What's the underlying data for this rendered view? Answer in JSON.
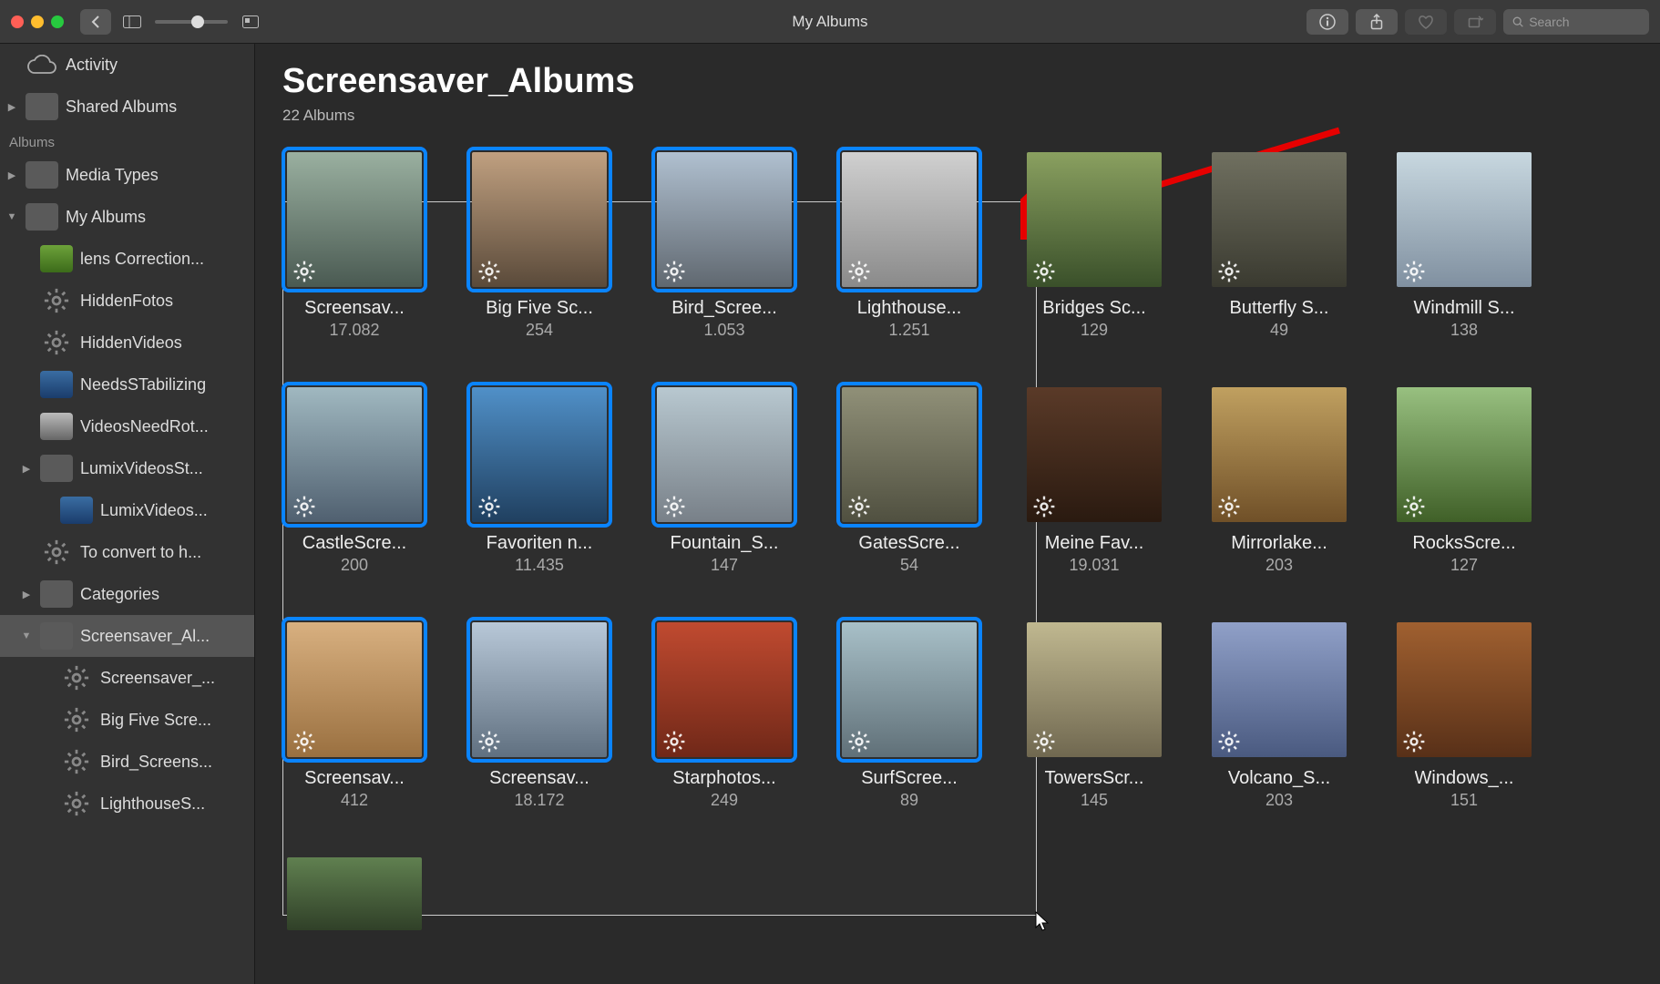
{
  "window": {
    "title": "My Albums"
  },
  "toolbar": {
    "search_placeholder": "Search"
  },
  "sidebar": {
    "activity_label": "Activity",
    "shared_albums_label": "Shared Albums",
    "section_label": "Albums",
    "media_types_label": "Media Types",
    "my_albums_label": "My Albums",
    "items": [
      {
        "label": "lens Correction...",
        "icon": "thumb-green"
      },
      {
        "label": "HiddenFotos",
        "icon": "gear"
      },
      {
        "label": "HiddenVideos",
        "icon": "gear"
      },
      {
        "label": "NeedsSTabilizing",
        "icon": "thumb-blue"
      },
      {
        "label": "VideosNeedRot...",
        "icon": "thumb-mix"
      },
      {
        "label": "LumixVideosSt...",
        "icon": "folder",
        "expandable": true
      },
      {
        "label": "LumixVideos...",
        "icon": "thumb-blue",
        "indent": 1
      },
      {
        "label": "To convert to h...",
        "icon": "gear"
      },
      {
        "label": "Categories",
        "icon": "folder",
        "expandable": true
      },
      {
        "label": "Screensaver_Al...",
        "icon": "folder",
        "expandable": true,
        "expanded": true,
        "selected": true
      },
      {
        "label": "Screensaver_...",
        "icon": "gear",
        "indent": 1
      },
      {
        "label": "Big Five Scre...",
        "icon": "gear",
        "indent": 1
      },
      {
        "label": "Bird_Screens...",
        "icon": "gear",
        "indent": 1
      },
      {
        "label": "LighthouseS...",
        "icon": "gear",
        "indent": 1
      }
    ]
  },
  "main": {
    "title": "Screensaver_Albums",
    "subtitle": "22 Albums",
    "albums": [
      {
        "name": "Screensav...",
        "count": "17.082",
        "selected": true,
        "t": 0
      },
      {
        "name": "Big Five Sc...",
        "count": "254",
        "selected": true,
        "t": 1
      },
      {
        "name": "Bird_Scree...",
        "count": "1.053",
        "selected": true,
        "t": 2
      },
      {
        "name": "Lighthouse...",
        "count": "1.251",
        "selected": true,
        "t": 3
      },
      {
        "name": "Bridges Sc...",
        "count": "129",
        "selected": false,
        "t": 4
      },
      {
        "name": "Butterfly S...",
        "count": "49",
        "selected": false,
        "t": 5
      },
      {
        "name": "Windmill S...",
        "count": "138",
        "selected": false,
        "t": 6
      },
      {
        "name": "CastleScre...",
        "count": "200",
        "selected": true,
        "t": 7
      },
      {
        "name": "Favoriten n...",
        "count": "11.435",
        "selected": true,
        "t": 8
      },
      {
        "name": "Fountain_S...",
        "count": "147",
        "selected": true,
        "t": 9
      },
      {
        "name": "GatesScre...",
        "count": "54",
        "selected": true,
        "t": 10
      },
      {
        "name": "Meine Fav...",
        "count": "19.031",
        "selected": false,
        "t": 11
      },
      {
        "name": "Mirrorlake...",
        "count": "203",
        "selected": false,
        "t": 12
      },
      {
        "name": "RocksScre...",
        "count": "127",
        "selected": false,
        "t": 13
      },
      {
        "name": "Screensav...",
        "count": "412",
        "selected": true,
        "t": 14
      },
      {
        "name": "Screensav...",
        "count": "18.172",
        "selected": true,
        "t": 15
      },
      {
        "name": "Starphotos...",
        "count": "249",
        "selected": true,
        "t": 16
      },
      {
        "name": "SurfScree...",
        "count": "89",
        "selected": true,
        "t": 17
      },
      {
        "name": "TowersScr...",
        "count": "145",
        "selected": false,
        "t": 18
      },
      {
        "name": "Volcano_S...",
        "count": "203",
        "selected": false,
        "t": 19
      },
      {
        "name": "Windows_...",
        "count": "151",
        "selected": false,
        "t": 20
      },
      {
        "name": "",
        "count": "",
        "selected": false,
        "t": 21,
        "partial": true
      }
    ]
  }
}
